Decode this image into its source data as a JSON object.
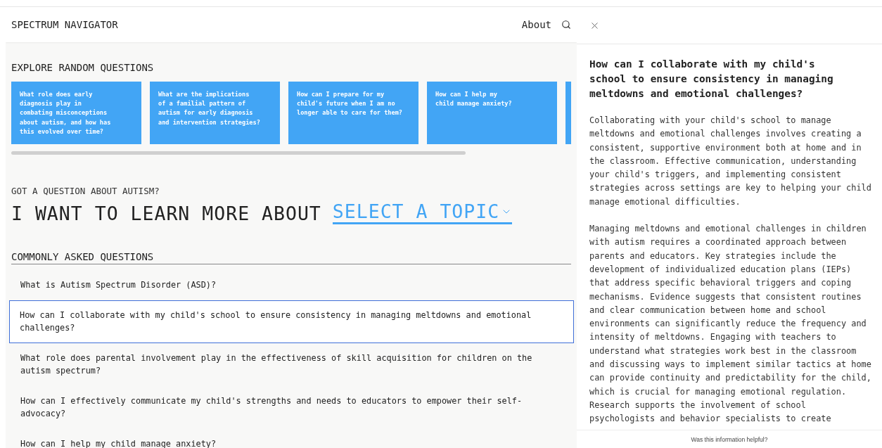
{
  "header": {
    "title": "SPECTRUM NAVIGATOR",
    "links": [
      {
        "label": "About"
      }
    ]
  },
  "random_questions": {
    "heading": "EXPLORE RANDOM QUESTIONS",
    "cards": [
      {
        "text": "What role does early\ndiagnosis play in\ncombating misconceptions\nabout autism, and how has\nthis evolved over time?"
      },
      {
        "text": "What are the implications\nof a familial pattern of\nautism for early diagnosis\nand intervention strategies?"
      },
      {
        "text": "How can I prepare for my\nchild's future when I am no\nlonger able to care for them?"
      },
      {
        "text": "How can I help my\nchild manage anxiety?"
      }
    ]
  },
  "topic": {
    "label": "GOT A QUESTION ABOUT AUTISM?",
    "prompt": "I WANT TO LEARN MORE ABOUT",
    "select": "SELECT A TOPIC"
  },
  "faq": {
    "heading": "COMMONLY ASKED QUESTIONS",
    "items": [
      {
        "text": "What is Autism Spectrum Disorder (ASD)?",
        "selected": false
      },
      {
        "text": "How can I collaborate with my child's school to ensure consistency in managing meltdowns and emotional challenges?",
        "selected": true
      },
      {
        "text": "What role does parental involvement play in the effectiveness of skill acquisition for children on the autism spectrum?",
        "selected": false
      },
      {
        "text": "How can I effectively communicate my child's strengths and needs to educators to empower their self-advocacy?",
        "selected": false
      },
      {
        "text": "How can I help my child manage anxiety?",
        "selected": false
      }
    ]
  },
  "answer": {
    "title": "How can I collaborate with my child's school to ensure consistency in managing meltdowns and emotional challenges?",
    "paragraphs": [
      "Collaborating with your child's school to manage meltdowns and emotional challenges involves creating a consistent, supportive environment both at home and in the classroom. Effective communication, understanding your child's triggers, and implementing consistent strategies across settings are key to helping your child manage emotional difficulties.",
      "Managing meltdowns and emotional challenges in children with autism requires a coordinated approach between parents and educators. Key strategies include the development of individualized education plans (IEPs) that address specific behavioral triggers and coping mechanisms. Evidence suggests that consistent routines and clear communication between home and school environments can significantly reduce the frequency and intensity of meltdowns. Engaging with teachers to understand what strategies work best in the classroom and discussing ways to implement similar tactics at home can provide continuity and predictability for the child, which is crucial for managing emotional regulation. Research supports the involvement of school psychologists and behavior specialists to create"
    ],
    "feedback": "Was this information helpful?"
  }
}
